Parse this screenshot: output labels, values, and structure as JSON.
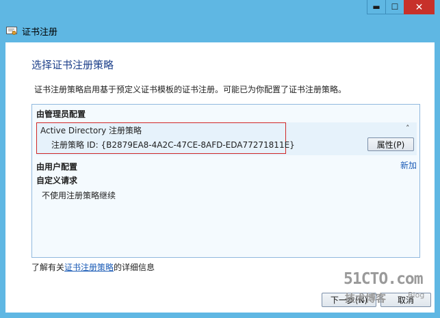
{
  "window": {
    "title": "证书注册",
    "controls": {
      "minimize": "▬",
      "maximize": "☐",
      "close": "✕"
    }
  },
  "page": {
    "heading": "选择证书注册策略",
    "description": "证书注册策略启用基于预定义证书模板的证书注册。可能已为你配置了证书注册策略。"
  },
  "policies": {
    "admin_group": "由管理员配置",
    "admin_item": {
      "title": "Active Directory 注册策略",
      "id_text": "注册策略 ID: {B2879EA8-4A2C-47CE-8AFD-EDA77271811E}",
      "collapse_glyph": "˄",
      "properties_button": "属性(P)"
    },
    "user_group": "由用户配置",
    "add_link": "新加",
    "custom_group": "自定义请求",
    "no_inherit": "不使用注册策略继续"
  },
  "footer": {
    "learn_prefix": "了解有关",
    "learn_link": "证书注册策略",
    "learn_suffix": "的详细信息",
    "next_button": "下一步(N)",
    "cancel_button": "取消"
  },
  "watermark": {
    "main": "51CTO.com",
    "sub": "技术博客",
    "blog": "Blog"
  },
  "colors": {
    "titlebar": "#5fb7e3",
    "close_button": "#c7312a",
    "heading": "#1c3f8a",
    "link": "#1a5bb6",
    "highlight_border": "#d02626"
  }
}
